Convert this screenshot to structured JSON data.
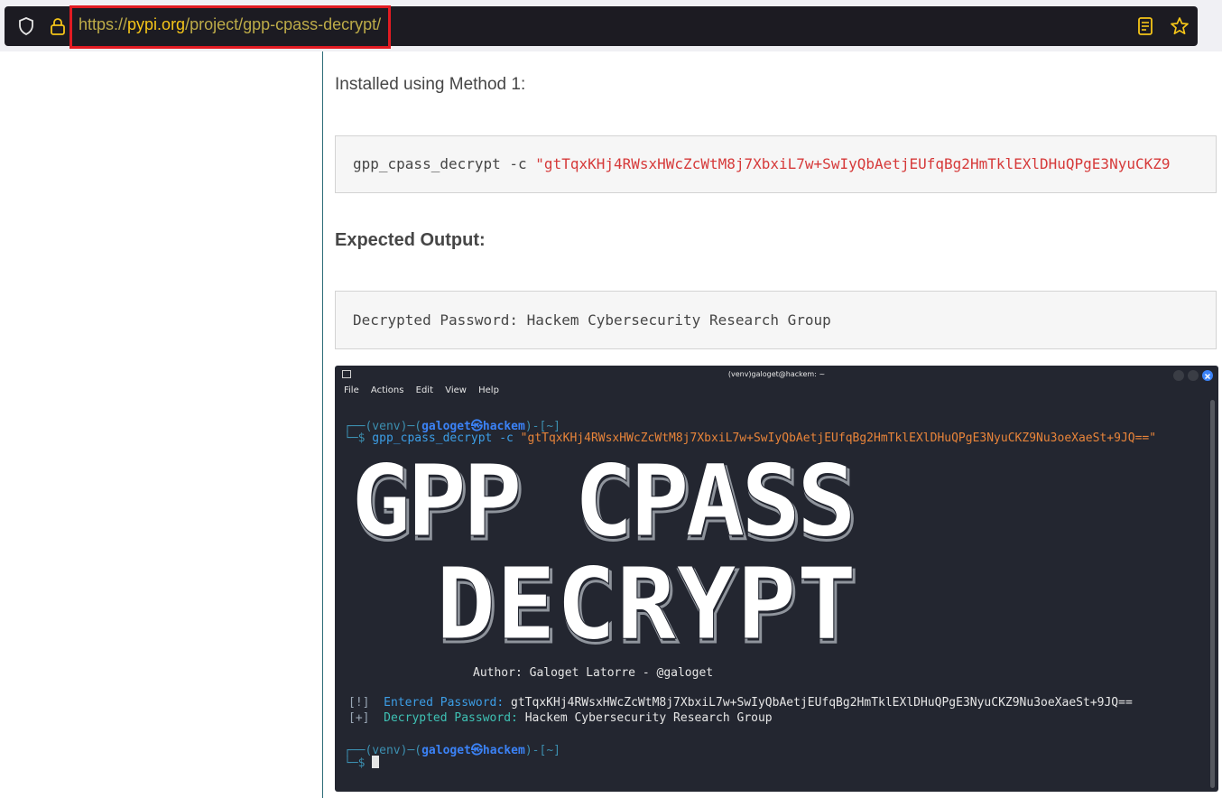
{
  "browser": {
    "url_prefix": "https://",
    "url_domain": "pypi.org",
    "url_path": "/project/gpp-cpass-decrypt/"
  },
  "page": {
    "intro": "Installed using Method 1:",
    "command": "gpp_cpass_decrypt -c",
    "command_arg": "\"gtTqxKHj4RWsxHWcZcWtM8j7XbxiL7w+SwIyQbAetjEUfqBg2HmTklEXlDHuQPgE3NyuCKZ9",
    "expected_heading": "Expected Output:",
    "expected_output": "Decrypted Password: Hackem Cybersecurity Research Group"
  },
  "terminal": {
    "title": "(venv)galoget@hackem: ~",
    "menu": [
      "File",
      "Actions",
      "Edit",
      "View",
      "Help"
    ],
    "prompt1": {
      "pre": "┌──(venv)─(",
      "user": "galoget㉿hackem",
      "post": ")-[~]",
      "dollar": "└─$",
      "cmd": " gpp_cpass_decrypt -c ",
      "arg": "\"gtTqxKHj4RWsxHWcZcWtM8j7XbxiL7w+SwIyQbAetjEUfqBg2HmTklEXlDHuQPgE3NyuCKZ9Nu3oeXaeSt+9JQ==\""
    },
    "banner_line1": "GPP CPASS",
    "banner_line2": "DECRYPT",
    "author": "Author: Galoget Latorre - @galoget",
    "entered": {
      "bracket": "[!]",
      "label": "Entered Password:",
      "value": "gtTqxKHj4RWsxHWcZcWtM8j7XbxiL7w+SwIyQbAetjEUfqBg2HmTklEXlDHuQPgE3NyuCKZ9Nu3oeXaeSt+9JQ=="
    },
    "decrypted": {
      "bracket": "[+]",
      "label": "Decrypted Password:",
      "value": "Hackem Cybersecurity Research Group"
    },
    "prompt2": {
      "pre": "┌──(venv)─(",
      "user": "galoget㉿hackem",
      "post": ")-[~]",
      "dollar": "└─$"
    }
  }
}
